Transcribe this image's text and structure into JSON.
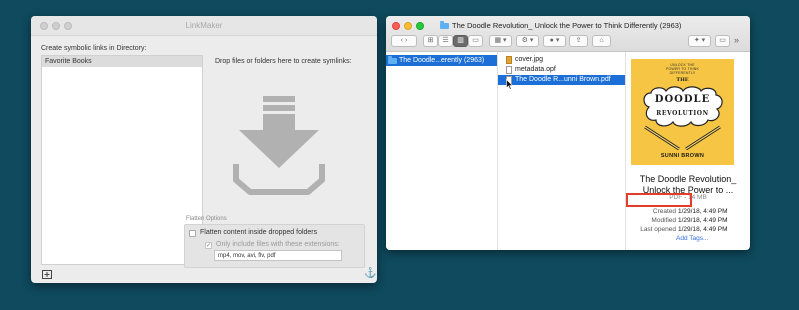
{
  "linkmaker": {
    "title": "LinkMaker",
    "dir_header": "Create symbolic links in Directory:",
    "directories": [
      "Favorite Books"
    ],
    "drop_label": "Drop files or folders here to create symlinks:",
    "options_header": "Flatten Options",
    "flatten_label": "Flatten content inside dropped folders",
    "only_include_label": "Only include files with these extensions:",
    "extensions_value": "mp4, mov, avi, flv, pdf",
    "anchor_glyph": "⚓",
    "help_glyph": "?"
  },
  "finder": {
    "title": "The Doodle Revolution_ Unlock the Power to Think Differently (2963)",
    "toolbar": {
      "nav_glyph": "‹ ›",
      "view_icon_glyph": "⊞",
      "view_list_glyph": "☰",
      "view_columns_glyph": "▥",
      "view_gallery_glyph": "▭",
      "arrange_glyph": "▦ ▾",
      "action_glyph": "⚙ ▾",
      "path_glyph": "● ▾",
      "share_glyph": "⇪",
      "tag_glyph": "⌂",
      "dropbox_glyph": "✦ ▾",
      "window_glyph": "▭",
      "more_glyph": "»"
    },
    "sidebar_selected": "The Doodle...erently (2963)",
    "files": [
      {
        "name": "cover.jpg",
        "kind": "image"
      },
      {
        "name": "metadata.opf",
        "kind": "doc"
      },
      {
        "name": "The Doodle R...unni Brown.pdf",
        "kind": "doc",
        "selected": true
      }
    ],
    "preview": {
      "book": {
        "tagline": "UNLOCK THE\nPOWER TO THINK\nDIFFERENTLY",
        "the": "THE",
        "doodle": "DOODLE",
        "revolution": "REVOLUTION",
        "author": "SUNNI BROWN"
      },
      "title": "The Doodle Revolution_ Unlock the Power to ...",
      "subtitle": "PDF - 14 MB",
      "created_label": "Created",
      "created_value": "1/29/18, 4:49 PM",
      "modified_label": "Modified",
      "modified_value": "1/29/18, 4:49 PM",
      "last_opened_label": "Last opened",
      "last_opened_value": "1/29/18, 4:49 PM",
      "add_tags": "Add Tags..."
    }
  }
}
